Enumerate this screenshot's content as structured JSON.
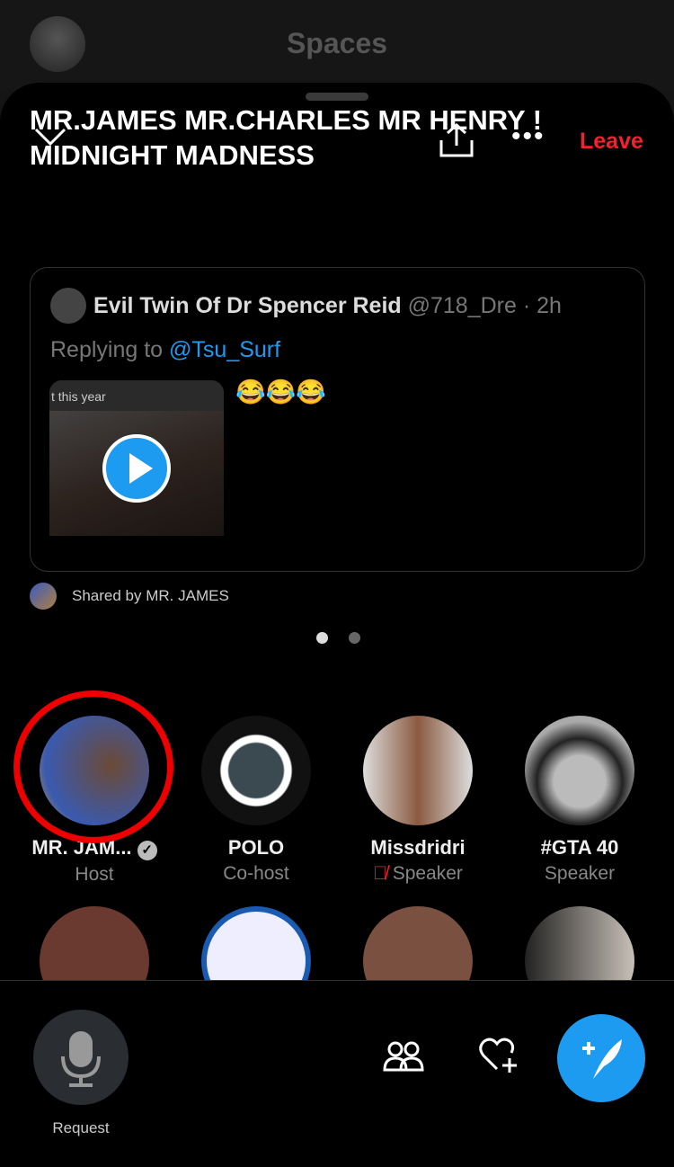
{
  "header": {
    "title": "Spaces"
  },
  "space": {
    "title": "MR.JAMES MR.CHARLES MR HENRY ! MIDNIGHT MADNESS",
    "leave_label": "Leave"
  },
  "tweet": {
    "author": "Evil Twin Of Dr Spencer Reid",
    "handle": "@718_Dre · 2h",
    "replying_prefix": "Replying to",
    "replying_to": "@Tsu_Surf",
    "media_caption": "t this year",
    "text": "😂😂😂"
  },
  "shared_by": "Shared by MR. JAMES",
  "pager": {
    "pages": 2,
    "current": 1
  },
  "speakers": [
    {
      "name": "MR. JAM...",
      "role": "Host",
      "verified": true,
      "color": "#8a6a4a"
    },
    {
      "name": "POLO",
      "role": "Co-host",
      "color": "#eee"
    },
    {
      "name": "Missdridri",
      "role": "Speaker",
      "muted": true,
      "color": "#b9a89a"
    },
    {
      "name": "#GTA 40",
      "role": "Speaker",
      "color": "#999"
    }
  ],
  "listeners_row": [
    {
      "color": "#6a3a30"
    },
    {
      "color": "#eef"
    },
    {
      "color": "#7a5040"
    },
    {
      "color": "#c8c0b8"
    }
  ],
  "bottom": {
    "request_label": "Request"
  },
  "colors": {
    "accent": "#1d9bf0",
    "leave": "#f4212e",
    "highlight_ring": "#e00000"
  }
}
